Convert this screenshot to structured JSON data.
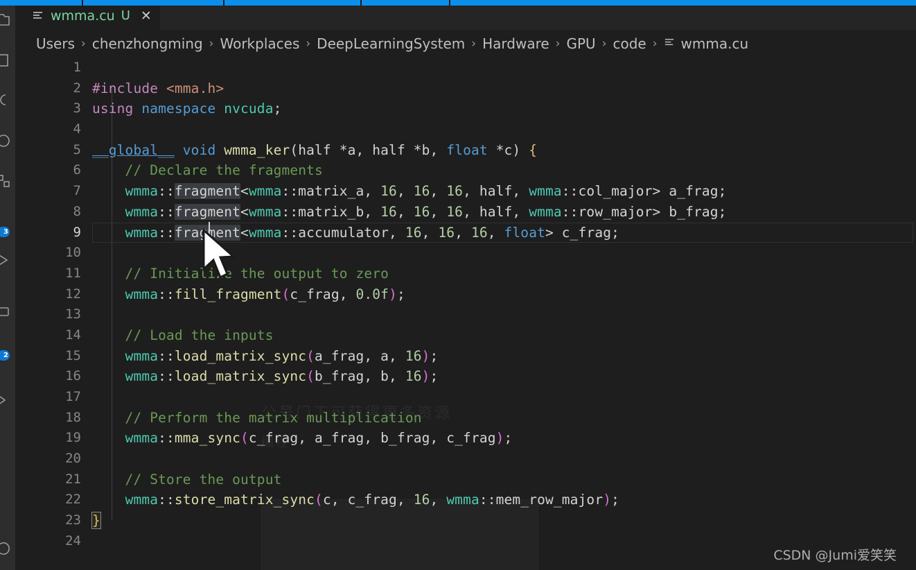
{
  "window": {
    "accent_color": "#0a8fec",
    "background": "#1e1e1e",
    "tab_bar_background": "#252526"
  },
  "activity_bar": {
    "items": [
      {
        "name": "explorer-icon",
        "badge": ""
      },
      {
        "name": "search-icon",
        "badge": ""
      },
      {
        "name": "source-control-icon",
        "badge": ""
      },
      {
        "name": "run-debug-icon",
        "badge": ""
      },
      {
        "name": "extensions-icon",
        "badge": "3"
      },
      {
        "name": "testing-icon",
        "badge": ""
      },
      {
        "name": "remote-explorer-icon",
        "badge": "2"
      },
      {
        "name": "chevron-icon",
        "badge": ""
      },
      {
        "name": "account-icon",
        "badge": ""
      }
    ]
  },
  "tab": {
    "icon": "code-file-icon",
    "label": "wmma.cu",
    "dirty_indicator": "U",
    "close_label": "✕",
    "label_color": "#7bd6a0"
  },
  "breadcrumb": {
    "separator": "›",
    "items": [
      "Users",
      "chenzhongming",
      "Workplaces",
      "DeepLearningSystem",
      "Hardware",
      "GPU",
      "code"
    ],
    "file": "wmma.cu",
    "file_icon": "code-file-icon"
  },
  "editor": {
    "language": "cuda",
    "active_line": 9,
    "cursor_position": {
      "line": 9,
      "column": 16
    },
    "selection_word": "fragment",
    "indent_guides": true,
    "line_count": 24,
    "lines": [
      {
        "n": "1",
        "text": ""
      },
      {
        "n": "2",
        "text": "#include <mma.h>"
      },
      {
        "n": "3",
        "text": "using namespace nvcuda;"
      },
      {
        "n": "4",
        "text": ""
      },
      {
        "n": "5",
        "text": "__global__ void wmma_ker(half *a, half *b, float *c) {"
      },
      {
        "n": "6",
        "text": "    // Declare the fragments"
      },
      {
        "n": "7",
        "text": "    wmma::fragment<wmma::matrix_a, 16, 16, 16, half, wmma::col_major> a_frag;"
      },
      {
        "n": "8",
        "text": "    wmma::fragment<wmma::matrix_b, 16, 16, 16, half, wmma::row_major> b_frag;"
      },
      {
        "n": "9",
        "text": "    wmma::fragment<wmma::accumulator, 16, 16, 16, float> c_frag;"
      },
      {
        "n": "10",
        "text": ""
      },
      {
        "n": "11",
        "text": "    // Initialize the output to zero"
      },
      {
        "n": "12",
        "text": "    wmma::fill_fragment(c_frag, 0.0f);"
      },
      {
        "n": "13",
        "text": ""
      },
      {
        "n": "14",
        "text": "    // Load the inputs"
      },
      {
        "n": "15",
        "text": "    wmma::load_matrix_sync(a_frag, a, 16);"
      },
      {
        "n": "16",
        "text": "    wmma::load_matrix_sync(b_frag, b, 16);"
      },
      {
        "n": "17",
        "text": ""
      },
      {
        "n": "18",
        "text": "    // Perform the matrix multiplication"
      },
      {
        "n": "19",
        "text": "    wmma::mma_sync(c_frag, a_frag, b_frag, c_frag);"
      },
      {
        "n": "20",
        "text": ""
      },
      {
        "n": "21",
        "text": "    // Store the output"
      },
      {
        "n": "22",
        "text": "    wmma::store_matrix_sync(c, c_frag, 16, wmma::mem_row_major);"
      },
      {
        "n": "23",
        "text": "}"
      },
      {
        "n": "24",
        "text": ""
      }
    ],
    "token_colors": {
      "preprocessor": "#c586c0",
      "string": "#ce9178",
      "keyword": "#569cd6",
      "type": "#4ec9b0",
      "function": "#dcdcaa",
      "number": "#b5cea8",
      "comment": "#6a9955",
      "plain": "#d4d4d4",
      "punctuation": "#da70d6",
      "bracket": "#d7ba7d"
    }
  },
  "watermark": {
    "text": "CSDN @Jumi爱笑笑"
  },
  "ghost_overlay": {
    "line1": "公号门下可获得更多资源",
    "line2": "编程"
  }
}
